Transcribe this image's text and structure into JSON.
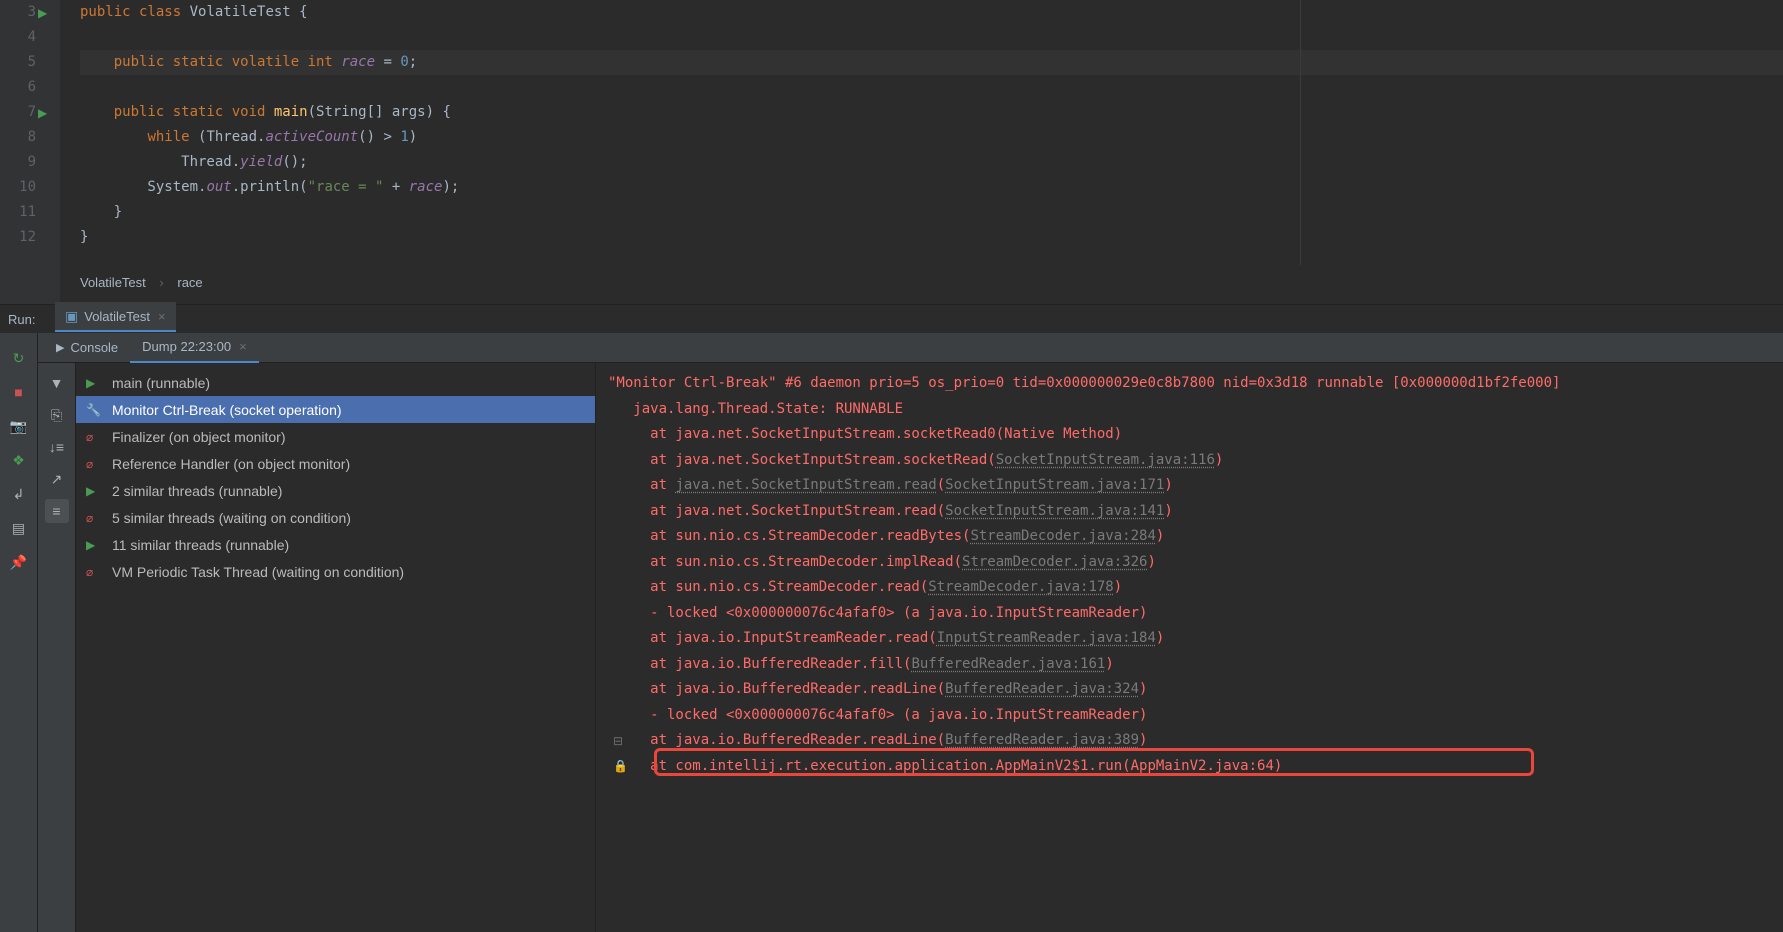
{
  "editor": {
    "lines": [
      "3",
      "4",
      "5",
      "6",
      "7",
      "8",
      "9",
      "10",
      "11",
      "12"
    ],
    "code": [
      {
        "html": "<span class='kw'>public class</span> VolatileTest {"
      },
      {
        "html": ""
      },
      {
        "html": "    <span class='kw'>public static volatile int</span> <span class='field'>race</span> = <span class='num-lit'>0</span>;",
        "current": true
      },
      {
        "html": ""
      },
      {
        "html": "    <span class='kw'>public static void</span> <span class='method'>main</span>(String[] args) {"
      },
      {
        "html": "        <span class='kw'>while</span> (Thread.<span class='field'>activeCount</span>() &gt; <span class='num-lit'>1</span>)"
      },
      {
        "html": "            Thread.<span class='field'>yield</span>();"
      },
      {
        "html": "        System.<span class='field'>out</span>.println(<span class='str'>\"race = \"</span> + <span class='field'>race</span>);"
      },
      {
        "html": "    }"
      },
      {
        "html": "}"
      }
    ],
    "breadcrumb": [
      "VolatileTest",
      "race"
    ]
  },
  "run": {
    "label": "Run:",
    "tab": "VolatileTest"
  },
  "console_tabs": [
    {
      "label": "Console",
      "icon": "▶"
    },
    {
      "label": "Dump 22:23:00",
      "active": true
    }
  ],
  "threads": [
    {
      "label": "main (runnable)",
      "icon": "▶",
      "color": "#499c54"
    },
    {
      "label": "Monitor Ctrl-Break (socket operation)",
      "icon": "🔧",
      "color": "#c28b5f",
      "selected": true
    },
    {
      "label": "Finalizer (on object monitor)",
      "icon": "⌀",
      "color": "#c75450"
    },
    {
      "label": "Reference Handler (on object monitor)",
      "icon": "⌀",
      "color": "#c75450"
    },
    {
      "label": "2 similar threads (runnable)",
      "icon": "▶",
      "color": "#499c54"
    },
    {
      "label": "5 similar threads (waiting on condition)",
      "icon": "⌀",
      "color": "#c75450"
    },
    {
      "label": "11 similar threads (runnable)",
      "icon": "▶",
      "color": "#499c54"
    },
    {
      "label": "VM Periodic Task Thread (waiting on condition)",
      "icon": "⌀",
      "color": "#c75450"
    }
  ],
  "trace": {
    "header": "\"Monitor Ctrl-Break\" #6 daemon prio=5 os_prio=0 tid=0x000000029e0c8b7800 nid=0x3d18 runnable [0x000000d1bf2fe000]",
    "state": "   java.lang.Thread.State: RUNNABLE",
    "lines": [
      {
        "pre": "     at java.net.SocketInputStream.socketRead0(Native Method)"
      },
      {
        "pre": "     at java.net.SocketInputStream.socketRead(",
        "link": "SocketInputStream.java:116",
        "post": ")"
      },
      {
        "pre": "     at ",
        "under": "java.net.SocketInputStream.read",
        "mid": "(",
        "link": "SocketInputStream.java:171",
        "post": ")"
      },
      {
        "pre": "     at java.net.SocketInputStream.read(",
        "link": "SocketInputStream.java:141",
        "post": ")"
      },
      {
        "pre": "     at sun.nio.cs.StreamDecoder.readBytes(",
        "link": "StreamDecoder.java:284",
        "post": ")"
      },
      {
        "pre": "     at sun.nio.cs.StreamDecoder.implRead(",
        "link": "StreamDecoder.java:326",
        "post": ")"
      },
      {
        "pre": "     at sun.nio.cs.StreamDecoder.read(",
        "link": "StreamDecoder.java:178",
        "post": ")"
      },
      {
        "pre": "     - locked <0x000000076c4afaf0> (a java.io.InputStreamReader)"
      },
      {
        "pre": "     at java.io.InputStreamReader.read(",
        "link": "InputStreamReader.java:184",
        "post": ")"
      },
      {
        "pre": "     at java.io.BufferedReader.fill(",
        "link": "BufferedReader.java:161",
        "post": ")"
      },
      {
        "pre": "     at java.io.BufferedReader.readLine(",
        "link": "BufferedReader.java:324",
        "post": ")"
      },
      {
        "pre": "     - locked <0x000000076c4afaf0> (a java.io.InputStreamReader)"
      },
      {
        "pre": "     at java.io.BufferedReader.readLine(",
        "link": "BufferedReader.java:389",
        "post": ")"
      },
      {
        "pre": "     at com.intellij.rt.execution.application.AppMainV2$1.run(AppMainV2.java:64)",
        "highlight": true
      }
    ]
  }
}
